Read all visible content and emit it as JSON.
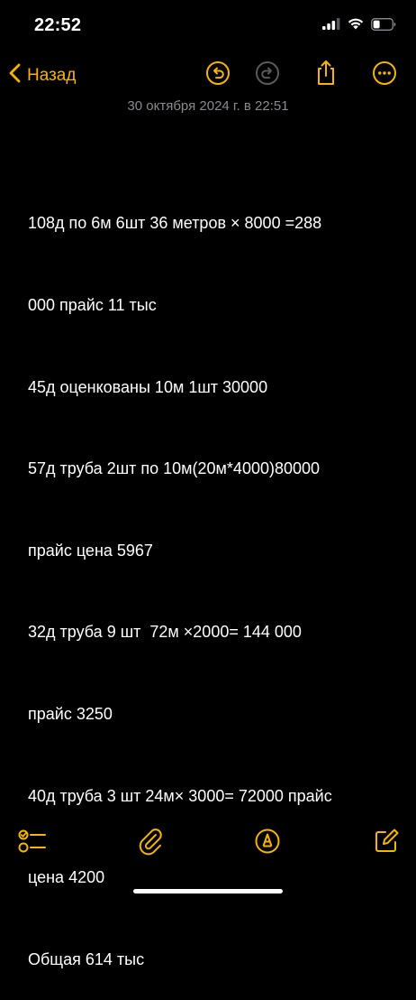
{
  "status_bar": {
    "time": "22:52"
  },
  "nav": {
    "back_label": "Назад",
    "icons": [
      "undo-icon",
      "redo-icon",
      "share-icon",
      "more-icon"
    ]
  },
  "note": {
    "date": "30 октября 2024 г. в 22:51",
    "lines": [
      "108д по 6м 6шт 36 метров × 8000 =288",
      "000 прайс 11 тыс",
      "45д оценкованы 10м 1шт 30000",
      "57д труба 2шт по 10м(20м*4000)80000",
      "прайс цена 5967",
      "32д труба 9 шт  72м ×2000= 144 000",
      "прайс 3250",
      "40д труба 3 шт 24м× 3000= 72000 прайс",
      "цена 4200",
      "Общая 614 тыс"
    ]
  },
  "colors": {
    "accent": "#f7b500",
    "background": "#000000",
    "text": "#ffffff",
    "secondary_text": "#8a8a8e",
    "disabled": "#5a5a5e"
  },
  "toolbar": {
    "icons": [
      "checklist-icon",
      "paperclip-icon",
      "markup-pen-icon",
      "compose-icon"
    ]
  }
}
